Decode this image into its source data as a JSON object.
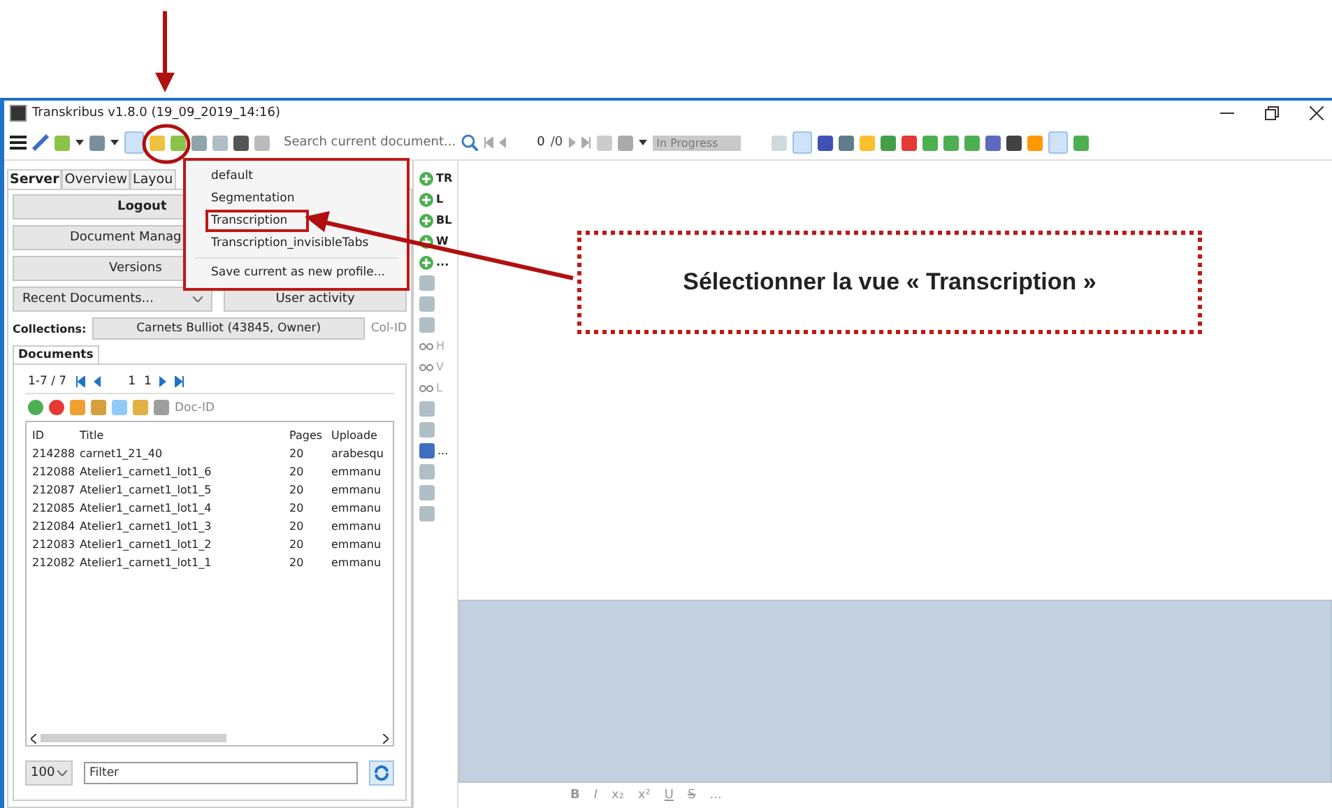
{
  "window": {
    "title": "Transkribus v1.8.0 (19_09_2019_14:16)"
  },
  "toolbar": {
    "search_placeholder": "Search current document...",
    "page_value": "0",
    "page_total": "/0",
    "status": "In Progress"
  },
  "profile_menu": {
    "items": [
      {
        "label": "default",
        "highlighted": false
      },
      {
        "label": "Segmentation",
        "highlighted": false
      },
      {
        "label": "Transcription",
        "highlighted": true
      },
      {
        "label": "Transcription_invisibleTabs",
        "highlighted": false
      }
    ],
    "save_label": "Save current as new profile..."
  },
  "left_panel": {
    "tabs": [
      {
        "label": "Server",
        "selected": true
      },
      {
        "label": "Overview",
        "selected": false
      },
      {
        "label": "Layou",
        "selected": false
      }
    ],
    "logout": "Logout",
    "document_manager": "Document Manag",
    "versions": "Versions",
    "recent": "Recent Documents...",
    "user_activity": "User activity",
    "collections_label": "Collections:",
    "collection": "Carnets Bulliot (43845, Owner)",
    "col_id": "Col-ID",
    "documents_tab": "Documents",
    "pager_range": "1-7 / 7",
    "pager_page": "1",
    "pager_total": "1",
    "doc_id": "Doc-ID",
    "table": {
      "columns": [
        "ID",
        "Title",
        "Pages",
        "Uploade"
      ],
      "rows": [
        [
          "214288",
          "carnet1_21_40",
          "20",
          "arabesqu"
        ],
        [
          "212088",
          "Atelier1_carnet1_lot1_6",
          "20",
          "emmanu"
        ],
        [
          "212087",
          "Atelier1_carnet1_lot1_5",
          "20",
          "emmanu"
        ],
        [
          "212085",
          "Atelier1_carnet1_lot1_4",
          "20",
          "emmanu"
        ],
        [
          "212084",
          "Atelier1_carnet1_lot1_3",
          "20",
          "emmanu"
        ],
        [
          "212083",
          "Atelier1_carnet1_lot1_2",
          "20",
          "emmanu"
        ],
        [
          "212082",
          "Atelier1_carnet1_lot1_1",
          "20",
          "emmanu"
        ]
      ]
    },
    "page_size": "100",
    "filter_placeholder": "Filter"
  },
  "side_tools": [
    {
      "kind": "add",
      "label": "TR"
    },
    {
      "kind": "add",
      "label": "L"
    },
    {
      "kind": "add",
      "label": "BL"
    },
    {
      "kind": "add",
      "label": "W"
    },
    {
      "kind": "add",
      "label": "..."
    },
    {
      "kind": "icon"
    },
    {
      "kind": "icon"
    },
    {
      "kind": "icon"
    },
    {
      "kind": "split",
      "label": "H"
    },
    {
      "kind": "split",
      "label": "V"
    },
    {
      "kind": "split",
      "label": "L"
    },
    {
      "kind": "icon"
    },
    {
      "kind": "icon"
    },
    {
      "kind": "pencil",
      "label": "..."
    },
    {
      "kind": "icon"
    },
    {
      "kind": "icon"
    },
    {
      "kind": "icon"
    }
  ],
  "format_bar": [
    "B",
    "I",
    "x₂",
    "x²",
    "U",
    "S",
    "..."
  ],
  "callout": {
    "text": "Sélectionner la vue « Transcription »"
  }
}
